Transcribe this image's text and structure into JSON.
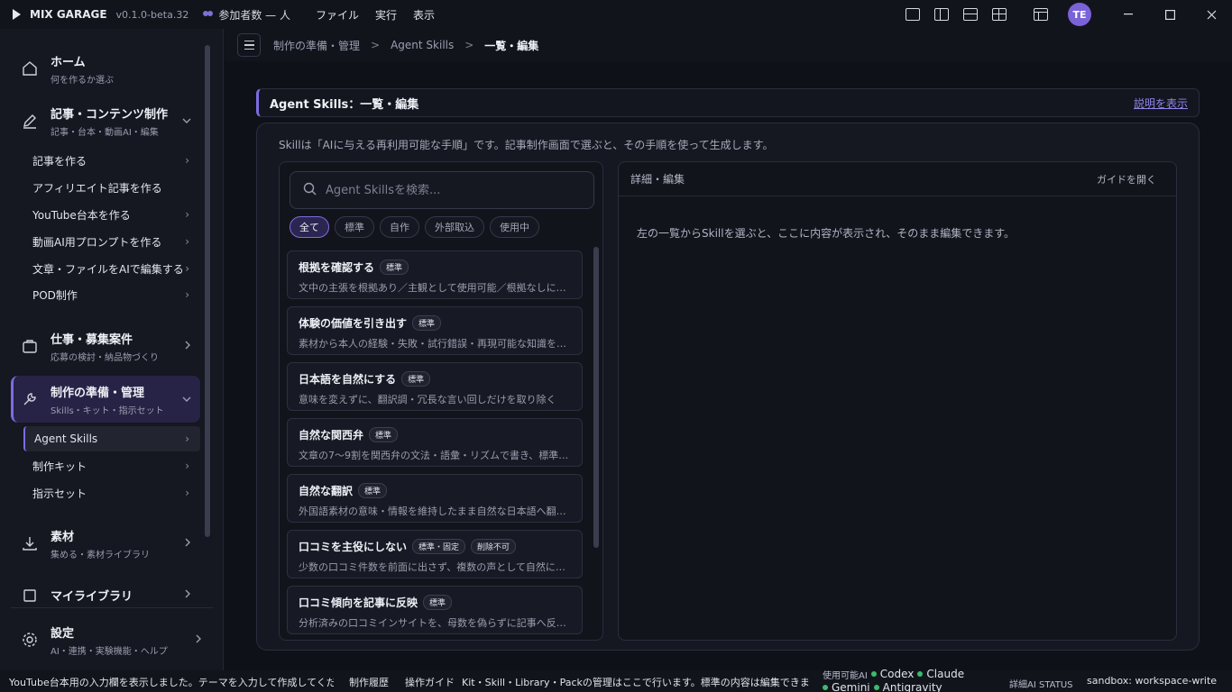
{
  "titlebar": {
    "app_name": "MIX GARAGE",
    "version": "v0.1.0-beta.32",
    "participants": "参加者数 — 人",
    "menus": [
      "ファイル",
      "実行",
      "表示"
    ],
    "avatar": "TE"
  },
  "sidebar": {
    "sections": [
      {
        "title": "ホーム",
        "subtitle": "何を作るか選ぶ"
      },
      {
        "title": "記事・コンテンツ制作",
        "subtitle": "記事・台本・動画AI・編集"
      },
      {
        "title": "仕事・募集案件",
        "subtitle": "応募の検討・納品物づくり"
      },
      {
        "title": "制作の準備・管理",
        "subtitle": "Skills・キット・指示セット"
      },
      {
        "title": "素材",
        "subtitle": "集める・素材ライブラリ"
      },
      {
        "title": "マイライブラリ",
        "subtitle": ""
      },
      {
        "title": "設定",
        "subtitle": "AI・連携・実験機能・ヘルプ"
      }
    ],
    "content_items": [
      "記事を作る",
      "アフィリエイト記事を作る",
      "YouTube台本を作る",
      "動画AI用プロンプトを作る",
      "文章・ファイルをAIで編集する",
      "POD制作"
    ],
    "prep_items": [
      "Agent Skills",
      "制作キット",
      "指示セット"
    ]
  },
  "breadcrumb": [
    "制作の準備・管理",
    "Agent Skills",
    "一覧・編集"
  ],
  "header": {
    "title": "Agent Skills：一覧・編集",
    "help_link": "説明を表示"
  },
  "intro": "Skillは「AIに与える再利用可能な手順」です。記事制作画面で選ぶと、その手順を使って生成します。",
  "search": {
    "placeholder": "Agent Skillsを検索..."
  },
  "filters": [
    "全て",
    "標準",
    "自作",
    "外部取込",
    "使用中"
  ],
  "skills": [
    {
      "title": "根拠を確認する",
      "badges": [
        "標準"
      ],
      "desc": "文中の主張を根拠あり／主観として使用可能／根拠なしに分類..."
    },
    {
      "title": "体験の価値を引き出す",
      "badges": [
        "標準"
      ],
      "desc": "素材から本人の経験・失敗・試行錯誤・再現可能な知識を、出..."
    },
    {
      "title": "日本語を自然にする",
      "badges": [
        "標準"
      ],
      "desc": "意味を変えずに、翻訳調・冗長な言い回しだけを取り除く"
    },
    {
      "title": "自然な関西弁",
      "badges": [
        "標準"
      ],
      "desc": "文章の7〜9割を関西弁の文法・語彙・リズムで書き、標準語主..."
    },
    {
      "title": "自然な翻訳",
      "badges": [
        "標準"
      ],
      "desc": "外国語素材の意味・情報を維持したまま自然な日本語へ翻訳する"
    },
    {
      "title": "口コミを主役にしない",
      "badges": [
        "標準・固定",
        "削除不可"
      ],
      "desc": "少数の口コミ件数を前面に出さず、複数の声として自然に扱い、..."
    },
    {
      "title": "口コミ傾向を記事に反映",
      "badges": [
        "標準"
      ],
      "desc": "分析済みの口コミインサイトを、母数を偽らずに記事へ反映する"
    }
  ],
  "detail": {
    "header": "詳細・編集",
    "guide": "ガイドを開く",
    "empty": "左の一覧からSkillを選ぶと、ここに内容が表示され、そのまま編集できます。"
  },
  "statusbar": {
    "message": "YouTube台本用の入力欄を表示しました。テーマを入力して作成してください。",
    "history": "制作履歴",
    "guide": "操作ガイド",
    "kit_msg": "Kit・Skill・Library・Packの管理はここで行います。標準の内容は編集できません（ࠋ",
    "ai_label": "使用可能AI",
    "ai_row1": [
      "Codex",
      "Claude"
    ],
    "ai_row2": [
      "Gemini",
      "Antigravity"
    ],
    "detail_status": "詳細AI STATUS",
    "sandbox": "sandbox: workspace-write"
  }
}
